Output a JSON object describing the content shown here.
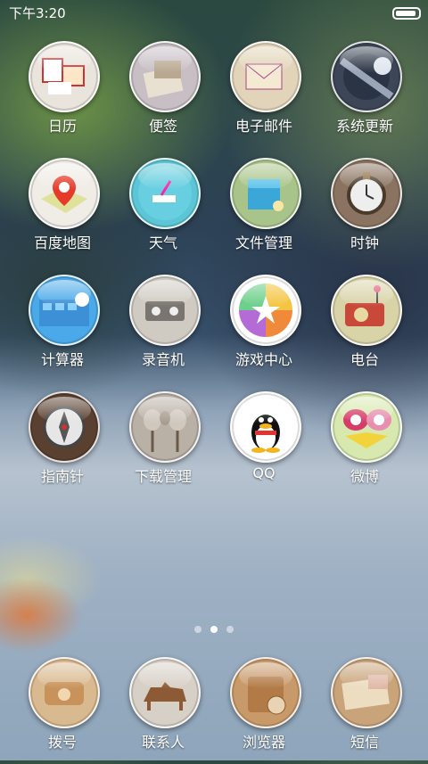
{
  "status_bar": {
    "time": "下午3:20",
    "battery_level": 0.9
  },
  "apps": [
    {
      "label": "日历",
      "icon": "calendar-icon",
      "color": "#e9e4dc"
    },
    {
      "label": "便签",
      "icon": "notes-icon",
      "color": "#c7bfc4"
    },
    {
      "label": "电子邮件",
      "icon": "email-icon",
      "color": "#e2d4b8"
    },
    {
      "label": "系统更新",
      "icon": "update-icon",
      "color": "#3c4656"
    },
    {
      "label": "百度地图",
      "icon": "map-icon",
      "color": "#f0ece6"
    },
    {
      "label": "天气",
      "icon": "weather-icon",
      "color": "#5cc6d6"
    },
    {
      "label": "文件管理",
      "icon": "folder-icon",
      "color": "#a9c48a"
    },
    {
      "label": "时钟",
      "icon": "clock-icon",
      "color": "#8a7360"
    },
    {
      "label": "计算器",
      "icon": "calculator-icon",
      "color": "#4aa9e8"
    },
    {
      "label": "录音机",
      "icon": "recorder-icon",
      "color": "#cfcac2"
    },
    {
      "label": "游戏中心",
      "icon": "game-icon",
      "color": "#ffffff"
    },
    {
      "label": "电台",
      "icon": "radio-icon",
      "color": "#d9d3a8"
    },
    {
      "label": "指南针",
      "icon": "compass-icon",
      "color": "#5a4030"
    },
    {
      "label": "下载管理",
      "icon": "download-icon",
      "color": "#b9b0a6"
    },
    {
      "label": "QQ",
      "icon": "qq-icon",
      "color": "#ffffff"
    },
    {
      "label": "微博",
      "icon": "weibo-icon",
      "color": "#d8e9b0"
    }
  ],
  "dock": [
    {
      "label": "拨号",
      "icon": "phone-icon",
      "color": "#d9b98f"
    },
    {
      "label": "联系人",
      "icon": "contacts-icon",
      "color": "#d7d0c6"
    },
    {
      "label": "浏览器",
      "icon": "browser-icon",
      "color": "#c89a6a"
    },
    {
      "label": "短信",
      "icon": "message-icon",
      "color": "#c9a47a"
    }
  ],
  "pager": {
    "pages": 3,
    "active": 1
  }
}
